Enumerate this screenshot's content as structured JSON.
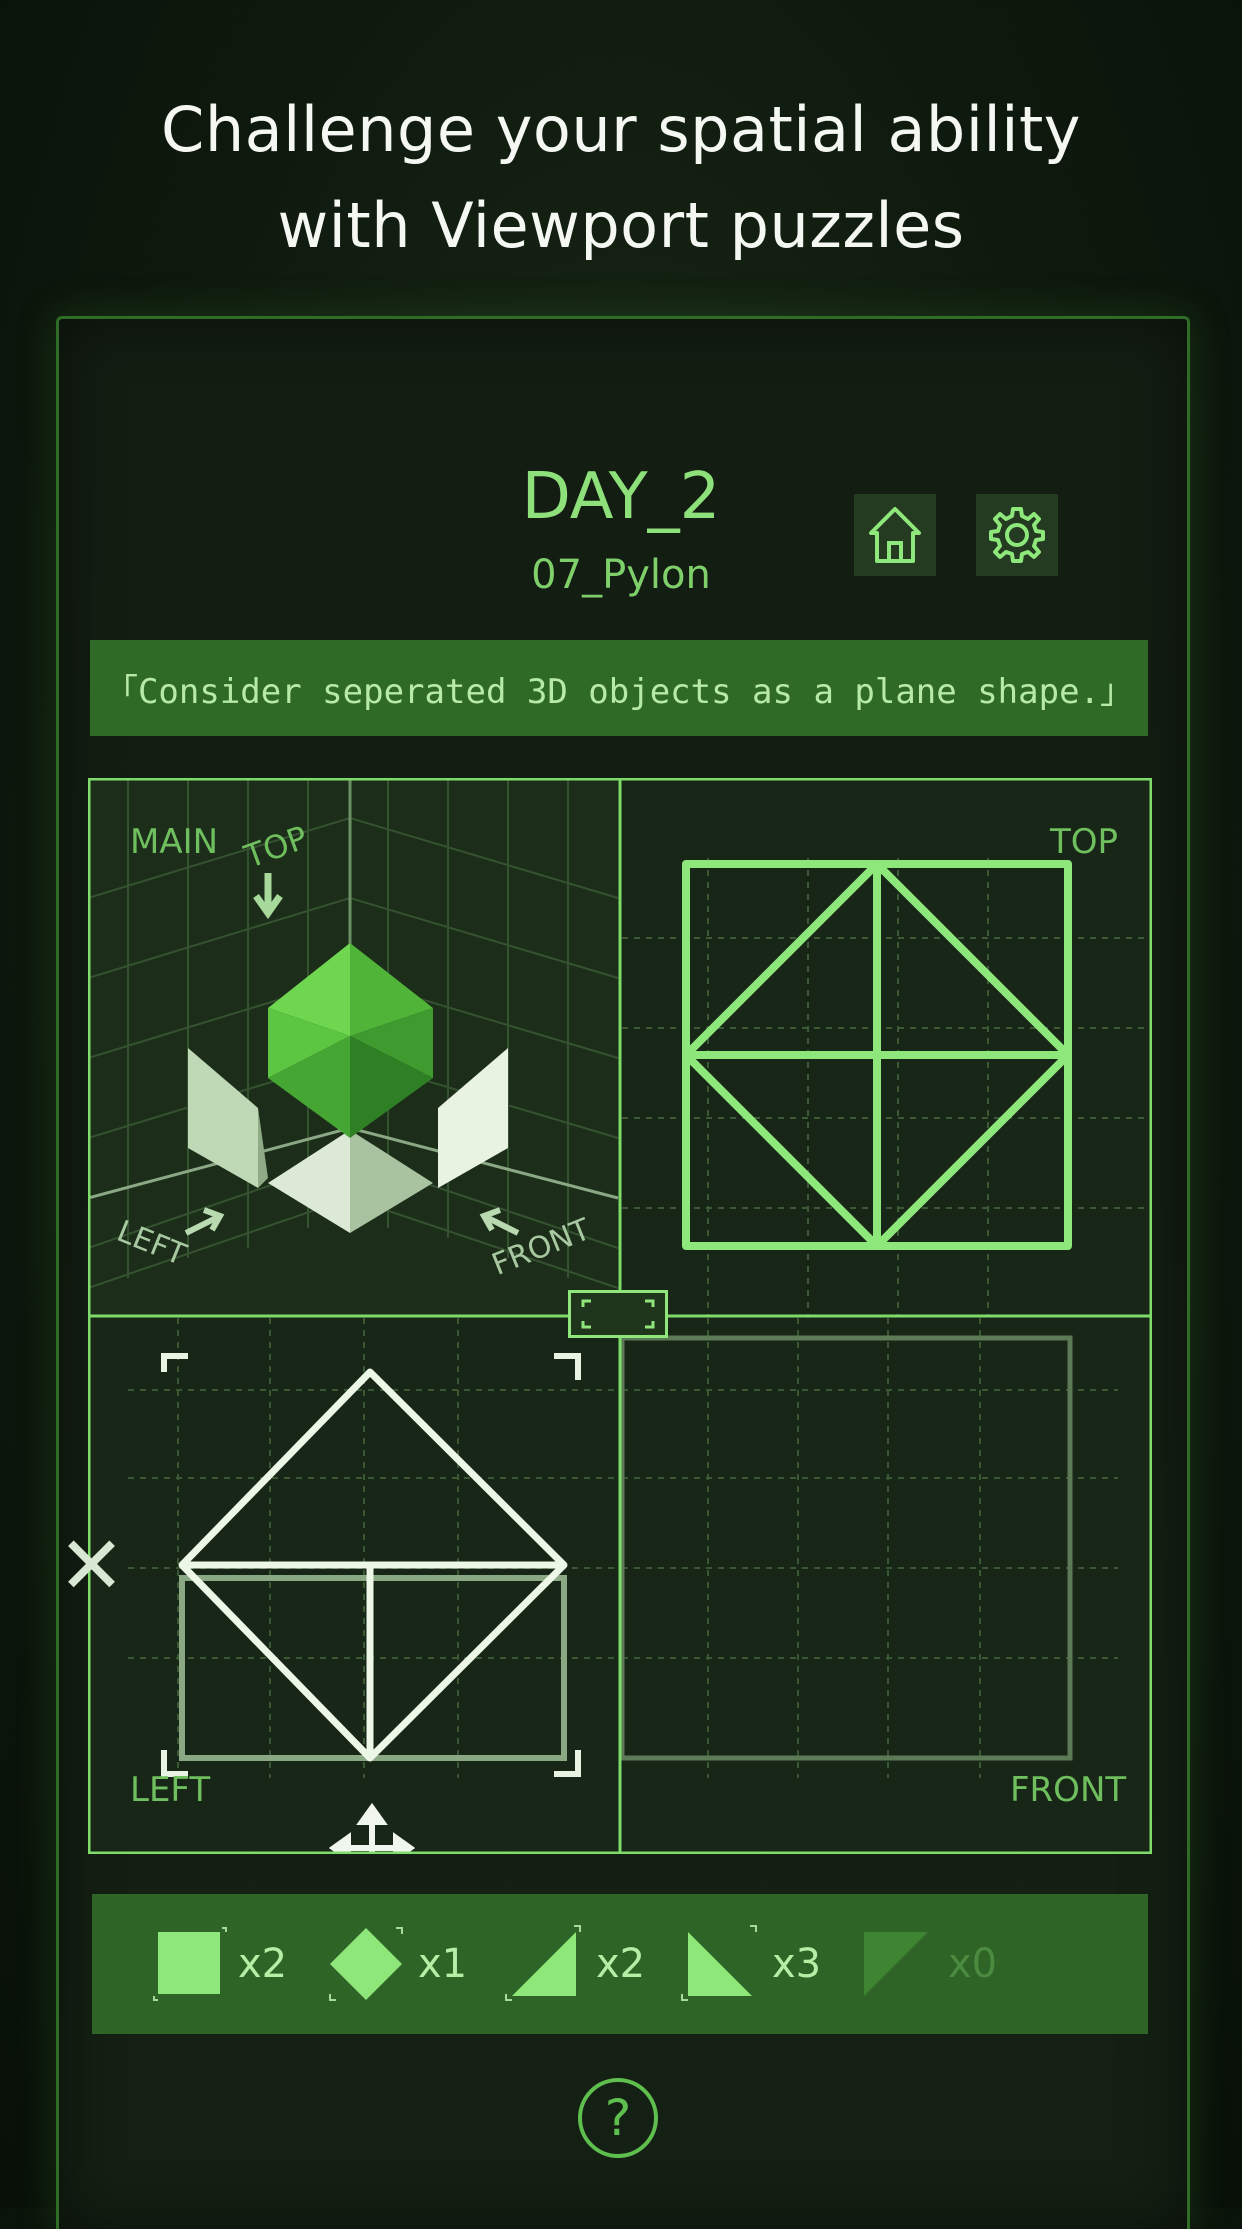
{
  "headline": {
    "line1": "Challenge your spatial ability",
    "line2": "with Viewport puzzles"
  },
  "header": {
    "day": "DAY_2",
    "level": "07_Pylon",
    "home_icon": "home-icon",
    "settings_icon": "gear-icon"
  },
  "hint": "「Consider seperated 3D objects as a plane shape.」",
  "viewports": {
    "main_label": "MAIN",
    "main_top_marker": "TOP",
    "main_left_marker": "LEFT",
    "main_front_marker": "FRONT",
    "top_label": "TOP",
    "left_label": "LEFT",
    "front_label": "FRONT"
  },
  "pieces": [
    {
      "shape": "square",
      "count": "x2"
    },
    {
      "shape": "diamond",
      "count": "x1"
    },
    {
      "shape": "triangle-right-up",
      "count": "x2"
    },
    {
      "shape": "triangle-left-down",
      "count": "x3"
    },
    {
      "shape": "triangle-dim",
      "count": "x0"
    }
  ],
  "help_label": "?",
  "colors": {
    "accent": "#8ee77b",
    "panel": "#2f6a27",
    "background": "#131d12"
  }
}
